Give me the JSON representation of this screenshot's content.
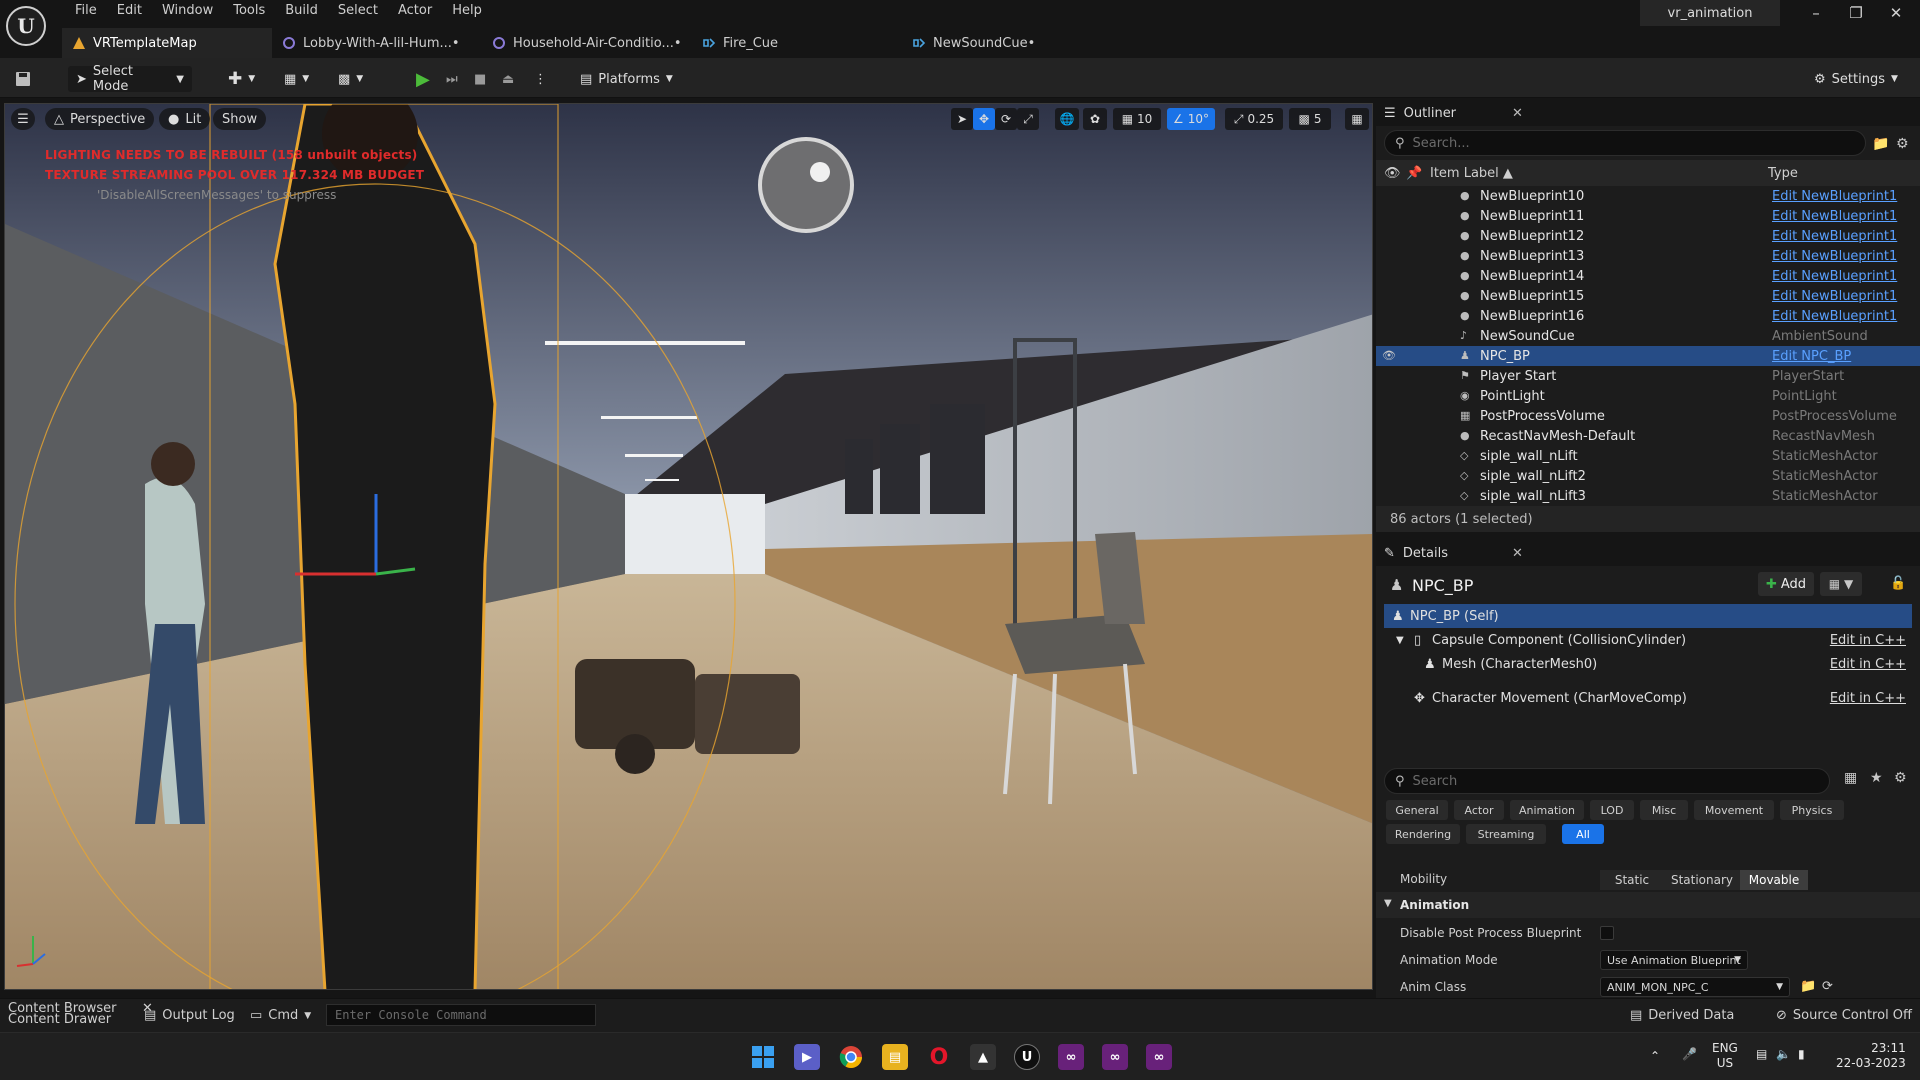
{
  "menu": {
    "items": [
      "File",
      "Edit",
      "Window",
      "Tools",
      "Build",
      "Select",
      "Actor",
      "Help"
    ],
    "project_name": "vr_animation"
  },
  "tabs": [
    {
      "label": "VRTemplateMap",
      "icon": "level-icon"
    },
    {
      "label": "Lobby-With-A-lil-Hum...•",
      "icon": "level-icon"
    },
    {
      "label": "Household-Air-Conditio...•",
      "icon": "level-icon"
    },
    {
      "label": "Fire_Cue",
      "icon": "sound-cue-icon"
    },
    {
      "label": "NewSoundCue•",
      "icon": "sound-cue-icon"
    }
  ],
  "toolbar": {
    "select_mode": "Select Mode",
    "platforms": "Platforms",
    "settings": "Settings"
  },
  "viewport": {
    "perspective": "Perspective",
    "lit": "Lit",
    "show": "Show",
    "grid_snap": "10",
    "rotation_snap": "10°",
    "scale_snap": "0.25",
    "camera_speed": "5",
    "warning_lighting": "LIGHTING NEEDS TO BE REBUILT (158 unbuilt objects)",
    "warning_texture": "TEXTURE STREAMING POOL OVER 117.324 MB BUDGET",
    "warning_hint": "'DisableAllScreenMessages' to suppress"
  },
  "outliner": {
    "title": "Outliner",
    "search_placeholder": "Search...",
    "col_label": "Item Label",
    "col_type": "Type",
    "rows": [
      {
        "label": "NewBlueprint10",
        "type": "Edit NewBlueprint1",
        "link": true,
        "icon": "actor-icon"
      },
      {
        "label": "NewBlueprint11",
        "type": "Edit NewBlueprint1",
        "link": true,
        "icon": "actor-icon"
      },
      {
        "label": "NewBlueprint12",
        "type": "Edit NewBlueprint1",
        "link": true,
        "icon": "actor-icon"
      },
      {
        "label": "NewBlueprint13",
        "type": "Edit NewBlueprint1",
        "link": true,
        "icon": "actor-icon"
      },
      {
        "label": "NewBlueprint14",
        "type": "Edit NewBlueprint1",
        "link": true,
        "icon": "actor-icon"
      },
      {
        "label": "NewBlueprint15",
        "type": "Edit NewBlueprint1",
        "link": true,
        "icon": "actor-icon"
      },
      {
        "label": "NewBlueprint16",
        "type": "Edit NewBlueprint1",
        "link": true,
        "icon": "actor-icon"
      },
      {
        "label": "NewSoundCue",
        "type": "AmbientSound",
        "link": false,
        "icon": "speaker-icon"
      },
      {
        "label": "NPC_BP",
        "type": "Edit NPC_BP",
        "link": true,
        "icon": "pawn-icon",
        "selected": true
      },
      {
        "label": "Player Start",
        "type": "PlayerStart",
        "link": false,
        "icon": "flag-icon"
      },
      {
        "label": "PointLight",
        "type": "PointLight",
        "link": false,
        "icon": "bulb-icon"
      },
      {
        "label": "PostProcessVolume",
        "type": "PostProcessVolume",
        "link": false,
        "icon": "volume-icon"
      },
      {
        "label": "RecastNavMesh-Default",
        "type": "RecastNavMesh",
        "link": false,
        "icon": "actor-icon"
      },
      {
        "label": "siple_wall_nLift",
        "type": "StaticMeshActor",
        "link": false,
        "icon": "mesh-icon"
      },
      {
        "label": "siple_wall_nLift2",
        "type": "StaticMeshActor",
        "link": false,
        "icon": "mesh-icon"
      },
      {
        "label": "siple_wall_nLift3",
        "type": "StaticMeshActor",
        "link": false,
        "icon": "mesh-icon"
      }
    ],
    "footer": "86 actors (1 selected)"
  },
  "details": {
    "title": "Details",
    "actor_name": "NPC_BP",
    "add_label": "Add",
    "components": [
      {
        "label": "NPC_BP (Self)",
        "edit": ""
      },
      {
        "label": "Capsule Component (CollisionCylinder)",
        "edit": "Edit in C++"
      },
      {
        "label": "Mesh (CharacterMesh0)",
        "edit": "Edit in C++"
      },
      {
        "label": "Character Movement (CharMoveComp)",
        "edit": "Edit in C++"
      }
    ],
    "search_placeholder": "Search",
    "filters_row1": [
      "General",
      "Actor",
      "Animation",
      "LOD",
      "Misc",
      "Movement",
      "Physics"
    ],
    "filters_row2": [
      "Rendering",
      "Streaming",
      "All"
    ],
    "mobility_label": "Mobility",
    "mobility_options": [
      "Static",
      "Stationary",
      "Movable"
    ],
    "mobility_value": "Movable",
    "section_animation": "Animation",
    "disable_pp_label": "Disable Post Process Blueprint",
    "anim_mode_label": "Animation Mode",
    "anim_mode_value": "Use Animation Blueprint",
    "anim_class_label": "Anim Class",
    "anim_class_value": "ANIM_MON_NPC_C"
  },
  "bottombar": {
    "content_browser": "Content Browser",
    "content_drawer": "Content Drawer",
    "output_log": "Output Log",
    "cmd": "Cmd",
    "console_placeholder": "Enter Console Command",
    "derived_data": "Derived Data",
    "source_control": "Source Control Off"
  },
  "taskbar": {
    "lang": "ENG",
    "region": "US",
    "time": "23:11",
    "date": "22-03-2023"
  },
  "colors": {
    "accent": "#1a73e8",
    "selection": "#264c86",
    "warning": "#e02b2b",
    "link": "#5aa0ff",
    "selection_outline": "#e8a530"
  }
}
